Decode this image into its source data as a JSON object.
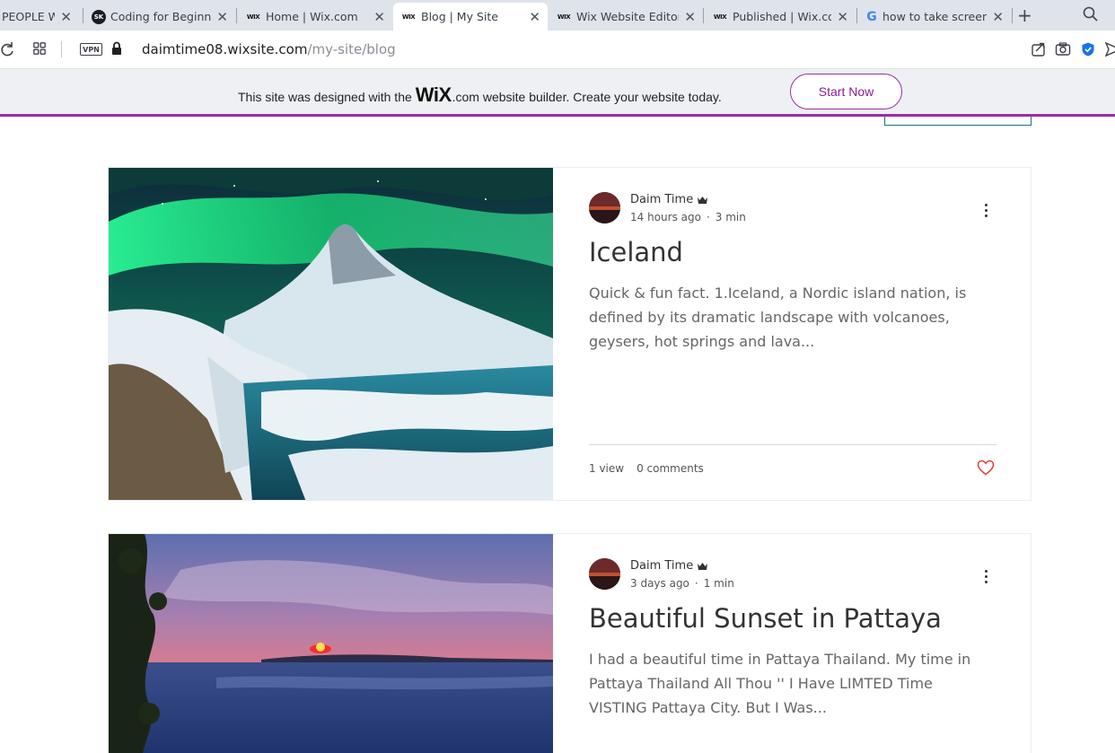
{
  "browser": {
    "tabs": [
      {
        "title": "PEOPLE W",
        "favicon": "none",
        "active": false
      },
      {
        "title": "Coding for Beginne",
        "favicon": "sk-badge-icon",
        "favicon_text": "SK",
        "active": false
      },
      {
        "title": "Home | Wix.com",
        "favicon": "wix-icon",
        "active": false
      },
      {
        "title": "Blog | My Site",
        "favicon": "wix-icon",
        "active": true
      },
      {
        "title": "Wix Website Editor",
        "favicon": "wix-icon",
        "active": false
      },
      {
        "title": "Published | Wix.com",
        "favicon": "wix-icon",
        "active": false
      },
      {
        "title": "how to take screens",
        "favicon": "google-icon",
        "active": false
      }
    ],
    "favicon_wix_text": "WIX",
    "favicon_google_text": "G",
    "close_glyph": "✕",
    "new_tab_glyph": "+",
    "address": {
      "vpn_label": "VPN",
      "url_host": "daimtime08.wixsite.com",
      "url_path": "/my-site/blog"
    }
  },
  "wix_banner": {
    "text_before": "This site was designed with the",
    "logo": "WiX",
    "text_after": ".com website builder. Create your website today.",
    "button_label": "Start Now",
    "accent_color": "#9b2ea6"
  },
  "posts": [
    {
      "author": "Daim Time",
      "time_ago": "14 hours ago",
      "read_time": "3 min",
      "separator": "·",
      "title": "Iceland",
      "excerpt": "Quick & fun fact. 1.Iceland, a Nordic island nation, is defined by its dramatic landscape with volcanoes, geysers, hot springs and lava...",
      "views": "1 view",
      "comments": "0 comments",
      "image": "aurora-mountain-waterfall"
    },
    {
      "author": "Daim Time",
      "time_ago": "3 days ago",
      "read_time": "1 min",
      "separator": "·",
      "title": "Beautiful Sunset in Pattaya",
      "excerpt": "I had a beautiful time in Pattaya Thailand. My time in Pattaya Thailand All Thou '' I Have LIMTED Time VISTING Pattaya City. But I Was...",
      "image": "sunset-over-sea"
    }
  ]
}
